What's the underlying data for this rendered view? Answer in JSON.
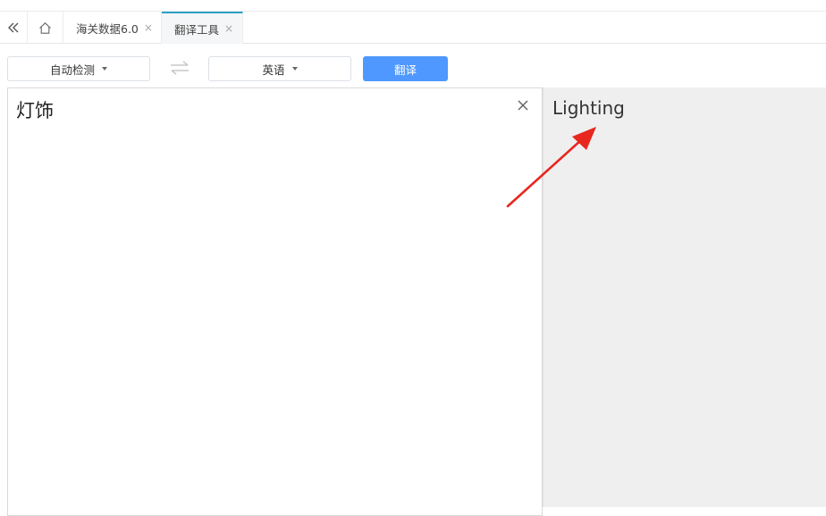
{
  "tabbar": {
    "collapse_icon": "double-chevron-left-icon",
    "home_icon": "home-icon",
    "tabs": [
      {
        "label": "海关数据6.0",
        "close": "×",
        "active": false
      },
      {
        "label": "翻译工具",
        "close": "×",
        "active": true
      }
    ]
  },
  "toolbar": {
    "source_lang": "自动检测",
    "target_lang": "英语",
    "swap_icon": "swap-arrows-icon",
    "translate_label": "翻译"
  },
  "source": {
    "text": "灯饰",
    "clear_icon": "close-icon"
  },
  "result": {
    "text": "Lighting"
  },
  "colors": {
    "accent": "#4e98ff",
    "tab_active_border": "#2c9fc6",
    "annotation_arrow": "#e8271e",
    "result_bg": "#efefef"
  }
}
